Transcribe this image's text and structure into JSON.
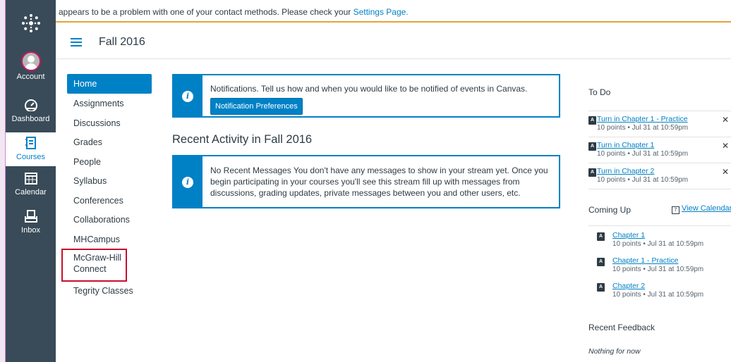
{
  "banner": {
    "text": "appears to be a problem with one of your contact methods. Please check your ",
    "link": "Settings Page."
  },
  "global_nav": {
    "items": [
      {
        "label": "Account",
        "icon": "avatar"
      },
      {
        "label": "Dashboard",
        "icon": "dashboard-icon"
      },
      {
        "label": "Courses",
        "icon": "courses-icon",
        "active": true
      },
      {
        "label": "Calendar",
        "icon": "calendar-icon"
      },
      {
        "label": "Inbox",
        "icon": "inbox-icon"
      }
    ]
  },
  "header": {
    "title": "Fall 2016"
  },
  "course_nav": {
    "items": [
      {
        "label": "Home"
      },
      {
        "label": "Assignments"
      },
      {
        "label": "Discussions"
      },
      {
        "label": "Grades"
      },
      {
        "label": "People"
      },
      {
        "label": "Syllabus"
      },
      {
        "label": "Conferences"
      },
      {
        "label": "Collaborations"
      },
      {
        "label": "MHCampus"
      },
      {
        "label": "McGraw-Hill Connect"
      },
      {
        "label": "Tegrity Classes"
      }
    ]
  },
  "notifications": {
    "text": "Notifications.  Tell us how and when you would like to be notified of events in Canvas.",
    "button": "Notification Preferences"
  },
  "recent_activity": {
    "title": "Recent Activity in Fall 2016",
    "message": "No Recent Messages  You don't have any messages to show in your stream yet. Once you begin participating in your courses you'll see this stream fill up with messages from discussions, grading updates, private messages between you and other users, etc."
  },
  "todo": {
    "title": "To Do",
    "items": [
      {
        "title": "Turn in Chapter 1 - Practice",
        "meta": "10 points • Jul 31 at 10:59pm"
      },
      {
        "title": "Turn in Chapter 1",
        "meta": "10 points • Jul 31 at 10:59pm"
      },
      {
        "title": "Turn in Chapter 2",
        "meta": "10 points • Jul 31 at 10:59pm"
      }
    ]
  },
  "coming_up": {
    "title": "Coming Up",
    "view_calendar": "View Calendar",
    "cal_number": "7",
    "items": [
      {
        "title": "Chapter 1",
        "meta": "10 points • Jul 31 at 10:59pm"
      },
      {
        "title": "Chapter 1 - Practice",
        "meta": "10 points • Jul 31 at 10:59pm"
      },
      {
        "title": "Chapter 2",
        "meta": "10 points • Jul 31 at 10:59pm"
      }
    ]
  },
  "recent_feedback": {
    "title": "Recent Feedback",
    "empty": "Nothing for now"
  },
  "colors": {
    "nav_bg": "#394b58",
    "accent": "#0081c6",
    "warning_border": "#e5a33b",
    "highlight": "#c8102e"
  }
}
